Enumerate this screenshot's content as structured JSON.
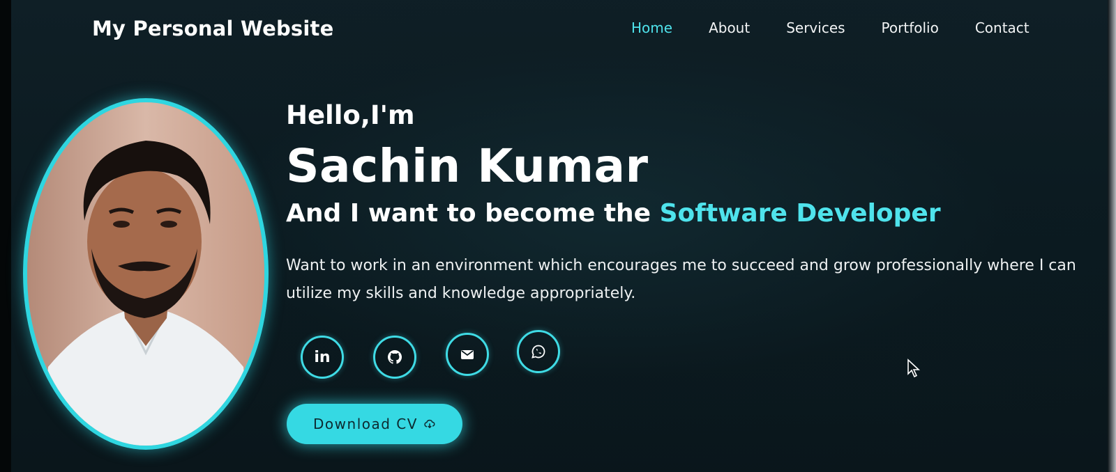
{
  "site": {
    "logo": "My Personal Website"
  },
  "nav": {
    "items": [
      {
        "label": "Home",
        "active": true
      },
      {
        "label": "About"
      },
      {
        "label": "Services"
      },
      {
        "label": "Portfolio"
      },
      {
        "label": "Contact"
      }
    ]
  },
  "hero": {
    "greeting": "Hello,I'm",
    "name": "Sachin Kumar",
    "tagline_prefix": "And I want to become the ",
    "tagline_accent": "Software Developer",
    "description": "Want to work in an environment which encourages me to succeed and grow professionally where I can utilize my skills and knowledge appropriately.",
    "cv_button": "Download CV"
  },
  "social": [
    {
      "icon": "linkedin-icon",
      "label": "in"
    },
    {
      "icon": "github-icon"
    },
    {
      "icon": "email-icon"
    },
    {
      "icon": "whatsapp-icon"
    }
  ],
  "colors": {
    "accent": "#4fe3ec",
    "background": "#0f1f26",
    "text": "#ffffff",
    "button_bg": "#35d9e3"
  }
}
